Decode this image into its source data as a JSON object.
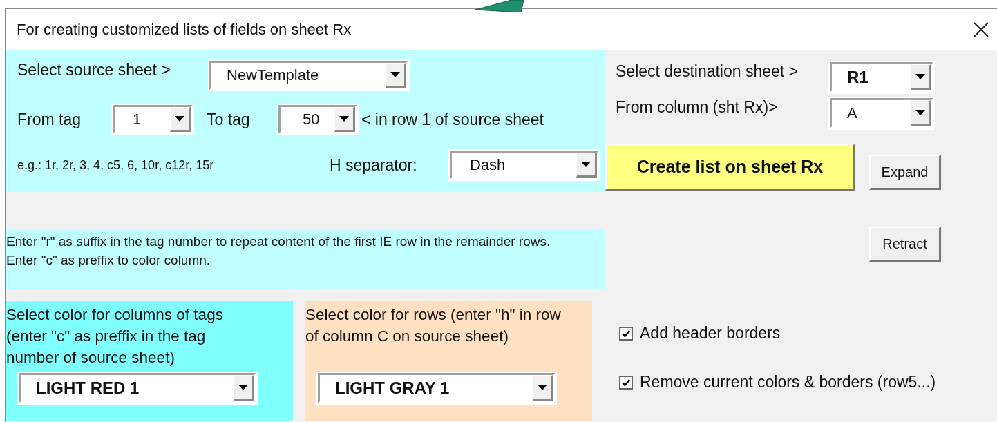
{
  "window": {
    "title": "For creating customized lists of fields on sheet Rx"
  },
  "source": {
    "label": "Select source sheet >",
    "value": "NewTemplate"
  },
  "from_tag": {
    "label": "From tag",
    "value": "1"
  },
  "to_tag": {
    "label": "To tag",
    "value": "50",
    "hint": "< in row 1 of source sheet"
  },
  "example": "e.g.: 1r, 2r, 3, 4, c5, 6, 10r, c12r, 15r",
  "separator": {
    "label": "H separator:",
    "value": "Dash"
  },
  "note": "Enter \"r\" as suffix in the tag number to repeat content of the first IE row in the remainder rows. Enter \"c\" as preffix to color column.",
  "column_color": {
    "label": "Select color for columns of tags (enter \"c\" as preffix in the  tag number of source sheet)",
    "value": "LIGHT RED 1"
  },
  "row_color": {
    "label": "Select color for rows (enter \"h\" in row of column C on source sheet)",
    "value": "LIGHT GRAY 1"
  },
  "destination": {
    "label": "Select destination sheet >",
    "value": "R1"
  },
  "from_column": {
    "label": "From column (sht Rx)>",
    "value": "A"
  },
  "buttons": [
    {
      "label": "Create list on sheet Rx",
      "kind": "primary"
    },
    {
      "label": "Expand",
      "kind": "plain"
    },
    {
      "label": "Retract",
      "kind": "plain"
    }
  ],
  "checkboxes": [
    {
      "label": "Add header borders",
      "checked": true
    },
    {
      "label": "Remove current colors & borders (row5...)",
      "checked": true
    }
  ]
}
